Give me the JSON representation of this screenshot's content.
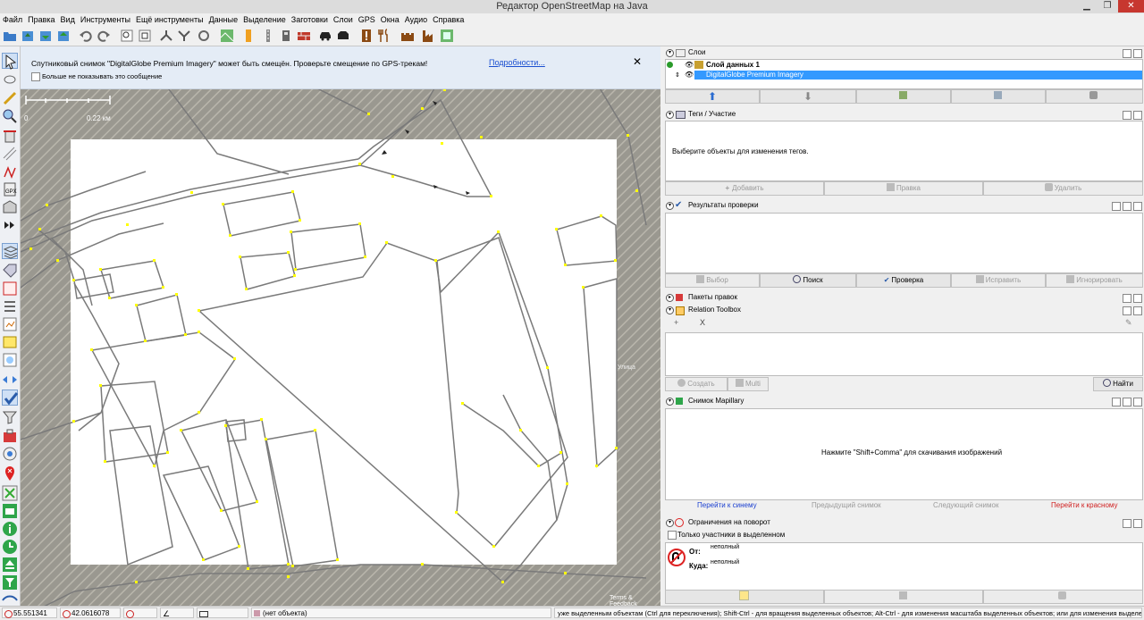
{
  "window": {
    "title": "Редактор OpenStreetMap на Java"
  },
  "menu": [
    "Файл",
    "Правка",
    "Вид",
    "Инструменты",
    "Ещё инструменты",
    "Данные",
    "Выделение",
    "Заготовки",
    "Слои",
    "GPS",
    "Окна",
    "Аудио",
    "Справка"
  ],
  "notification": {
    "text": "Спутниковый снимок \"DigitalGlobe Premium Imagery\" может быть смещён. Проверьте смещение по GPS-трекам!",
    "link": "Подробности...",
    "close": "✕",
    "checkbox_label": "Больше не показывать это сообщение"
  },
  "map": {
    "scale_min": "0",
    "scale_max": "0.22 км",
    "attribution": "Terms & Feedback",
    "edge_label": "Улица"
  },
  "layers_panel": {
    "title": "Слои",
    "layers": [
      {
        "name": "Слой данных 1",
        "selected": false
      },
      {
        "name": "DigitalGlobe Premium Imagery",
        "selected": true
      }
    ]
  },
  "tags_panel": {
    "title": "Теги / Участие",
    "empty_text": "Выберите объекты для изменения тегов.",
    "add": "Добавить",
    "edit": "Правка",
    "delete": "Удалить"
  },
  "validation_panel": {
    "title": "Результаты проверки",
    "select": "Выбор",
    "search": "Поиск",
    "validate": "Проверка",
    "fix": "Исправить",
    "ignore": "Игнорировать"
  },
  "changesets_panel": {
    "title": "Пакеты правок"
  },
  "relation_panel": {
    "title": "Relation Toolbox",
    "create": "Создать",
    "multi": "Multi",
    "find": "Найти"
  },
  "mapillary_panel": {
    "title": "Снимок Mapillary",
    "hint": "Нажмите \"Shift+Comma\" для скачивания изображений",
    "go_blue": "Перейти к синему",
    "prev": "Предыдущий снимок",
    "next": "Следующий снимок",
    "go_red": "Перейти к красному"
  },
  "turn_panel": {
    "title": "Ограничения на поворот",
    "only_selected": "Только участники в выделенном",
    "from_label": "От:",
    "from_value": "неполный",
    "to_label": "Куда:",
    "to_value": "неполный"
  },
  "statusbar": {
    "lat": "55.551341",
    "lon": "42.0616078",
    "object": "(нет объекта)",
    "help": "уже выделенным объектам (Ctrl для переключения); Shift-Ctrl - для вращения выделенных объектов; Alt-Ctrl - для изменения масштаба выделенных объектов; или для изменения выделения"
  },
  "colors": {
    "accent": "#3399ff",
    "map_bg": "#9a9890",
    "canvas": "#ffffff",
    "way": "#777777",
    "node": "#ffff00"
  }
}
